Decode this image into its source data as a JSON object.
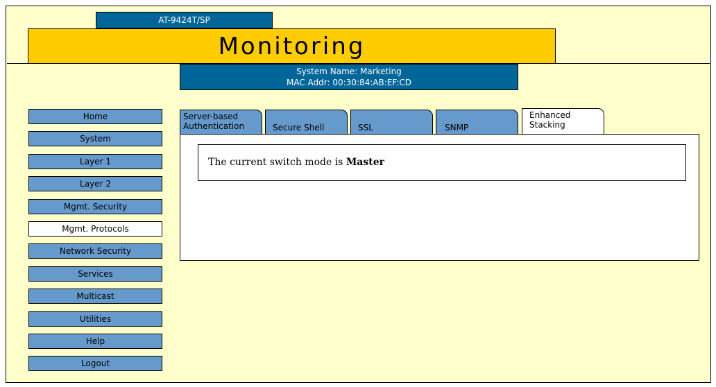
{
  "header": {
    "model": "AT-9424T/SP",
    "title": "Monitoring",
    "system_name": "System Name: Marketing",
    "mac_addr": "MAC Addr: 00:30:84:AB:EF:CD"
  },
  "nav": {
    "items": [
      {
        "label": "Home"
      },
      {
        "label": "System"
      },
      {
        "label": "Layer 1"
      },
      {
        "label": "Layer 2"
      },
      {
        "label": "Mgmt. Security"
      },
      {
        "label": "Mgmt. Protocols",
        "active": true
      },
      {
        "label": "Network Security"
      },
      {
        "label": "Services"
      },
      {
        "label": "Multicast"
      },
      {
        "label": "Utilities"
      },
      {
        "label": "Help"
      },
      {
        "label": "Logout"
      }
    ]
  },
  "tabs": {
    "server_auth_line1": "Server-based",
    "server_auth_line2": "Authentication",
    "secure_shell": "Secure Shell",
    "ssl": "SSL",
    "snmp": "SNMP",
    "stacking_line1": "Enhanced",
    "stacking_line2": "Stacking"
  },
  "content": {
    "mode_prefix": "The current switch mode is ",
    "mode_value": "Master"
  },
  "colors": {
    "background": "#ffffcc",
    "title_bar": "#ffcc00",
    "header_blue": "#006699",
    "button_blue": "#6699cc"
  }
}
